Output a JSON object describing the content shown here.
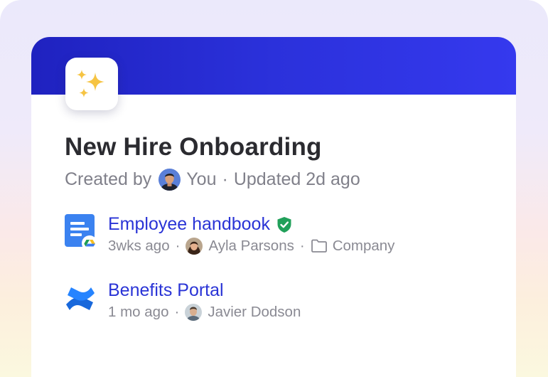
{
  "card": {
    "title": "New Hire Onboarding",
    "created_by_label": "Created by",
    "creator": "You",
    "separator": "·",
    "updated": "Updated 2d ago",
    "app_icon": "sparkles-icon"
  },
  "items": [
    {
      "title": "Employee handbook",
      "verified": true,
      "age": "3wks ago",
      "author": "Ayla Parsons",
      "location": "Company",
      "source_icon": "google-docs-icon"
    },
    {
      "title": "Benefits Portal",
      "age": "1 mo ago",
      "author": "Javier Dodson",
      "source_icon": "confluence-icon"
    }
  ],
  "colors": {
    "banner": "#2b31db",
    "link": "#2a34d6",
    "title": "#2b2b30",
    "muted": "#80808a",
    "verified": "#21a05a"
  }
}
